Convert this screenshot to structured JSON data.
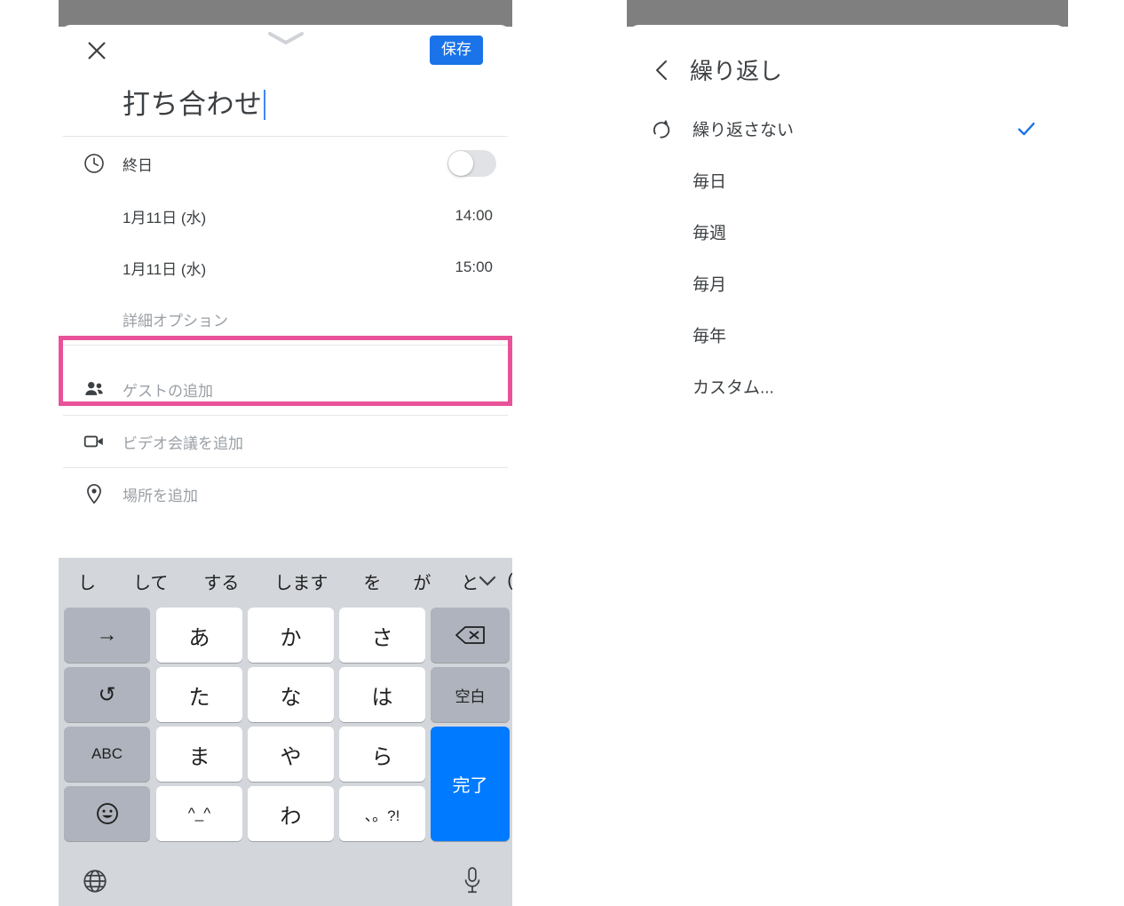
{
  "left_panel": {
    "topbar": {
      "close_icon": "close-icon",
      "grabber_icon": "chevron-down-grabber-icon",
      "save_label": "保存"
    },
    "event_title": "打ち合わせ",
    "rows": [
      {
        "icon": "clock-icon",
        "label": "終日",
        "value": "",
        "muted": false,
        "control": "toggle",
        "toggle_on": false
      },
      {
        "icon": "",
        "label": "1月11日 (水)",
        "value": "14:00",
        "muted": false,
        "control": ""
      },
      {
        "icon": "",
        "label": "1月11日 (水)",
        "value": "15:00",
        "muted": false,
        "control": ""
      },
      {
        "icon": "",
        "label": "詳細オプション",
        "value": "",
        "muted": true,
        "control": ""
      },
      {
        "icon": "people-icon",
        "label": "ゲストの追加",
        "value": "",
        "muted": true,
        "control": ""
      },
      {
        "icon": "video-icon",
        "label": "ビデオ会議を追加",
        "value": "",
        "muted": true,
        "control": ""
      },
      {
        "icon": "pin-icon",
        "label": "場所を追加",
        "value": "",
        "muted": true,
        "control": ""
      }
    ],
    "highlight": {
      "target_label": "詳細オプション",
      "color": "#e8559e"
    }
  },
  "keyboard": {
    "suggestions": [
      "し",
      "して",
      "する",
      "します",
      "を",
      "が",
      "と",
      "("
    ],
    "expand_icon": "chevron-down-icon",
    "keys": [
      {
        "label": "→",
        "style": "dark",
        "name": "key-cursor-right"
      },
      {
        "label": "あ",
        "style": "light",
        "name": "key-a"
      },
      {
        "label": "か",
        "style": "light",
        "name": "key-ka"
      },
      {
        "label": "さ",
        "style": "light",
        "name": "key-sa"
      },
      {
        "label": "",
        "style": "dark",
        "name": "key-backspace",
        "icon": "backspace-icon"
      },
      {
        "label": "↺",
        "style": "dark",
        "name": "key-undo"
      },
      {
        "label": "た",
        "style": "light",
        "name": "key-ta"
      },
      {
        "label": "な",
        "style": "light",
        "name": "key-na"
      },
      {
        "label": "は",
        "style": "light",
        "name": "key-ha"
      },
      {
        "label": "空白",
        "style": "dark",
        "name": "key-space"
      },
      {
        "label": "ABC",
        "style": "dark",
        "name": "key-abc"
      },
      {
        "label": "ま",
        "style": "light",
        "name": "key-ma"
      },
      {
        "label": "や",
        "style": "light",
        "name": "key-ya"
      },
      {
        "label": "ら",
        "style": "light",
        "name": "key-ra"
      },
      {
        "label": "完了",
        "style": "blue",
        "name": "key-done"
      },
      {
        "label": "",
        "style": "dark",
        "name": "key-emoji",
        "icon": "emoji-icon"
      },
      {
        "label": "^_^",
        "style": "light",
        "name": "key-kaomoji"
      },
      {
        "label": "わ",
        "style": "light",
        "name": "key-wa"
      },
      {
        "label": "、。?!",
        "style": "light",
        "name": "key-punctuation"
      }
    ],
    "bottom": {
      "globe_icon": "globe-icon",
      "mic_icon": "microphone-icon"
    }
  },
  "right_panel": {
    "back_icon": "back-chevron-icon",
    "title": "繰り返し",
    "items": [
      {
        "label": "繰り返さない",
        "icon": "repeat-icon",
        "selected": true
      },
      {
        "label": "毎日",
        "icon": "",
        "selected": false
      },
      {
        "label": "毎週",
        "icon": "",
        "selected": false
      },
      {
        "label": "毎月",
        "icon": "",
        "selected": false
      },
      {
        "label": "毎年",
        "icon": "",
        "selected": false
      },
      {
        "label": "カスタム...",
        "icon": "",
        "selected": false
      }
    ]
  },
  "colors": {
    "accent_blue": "#1a73e8",
    "key_blue": "#007aff",
    "highlight_pink": "#e8559e",
    "statusbar_gray": "#7f7f7f"
  }
}
